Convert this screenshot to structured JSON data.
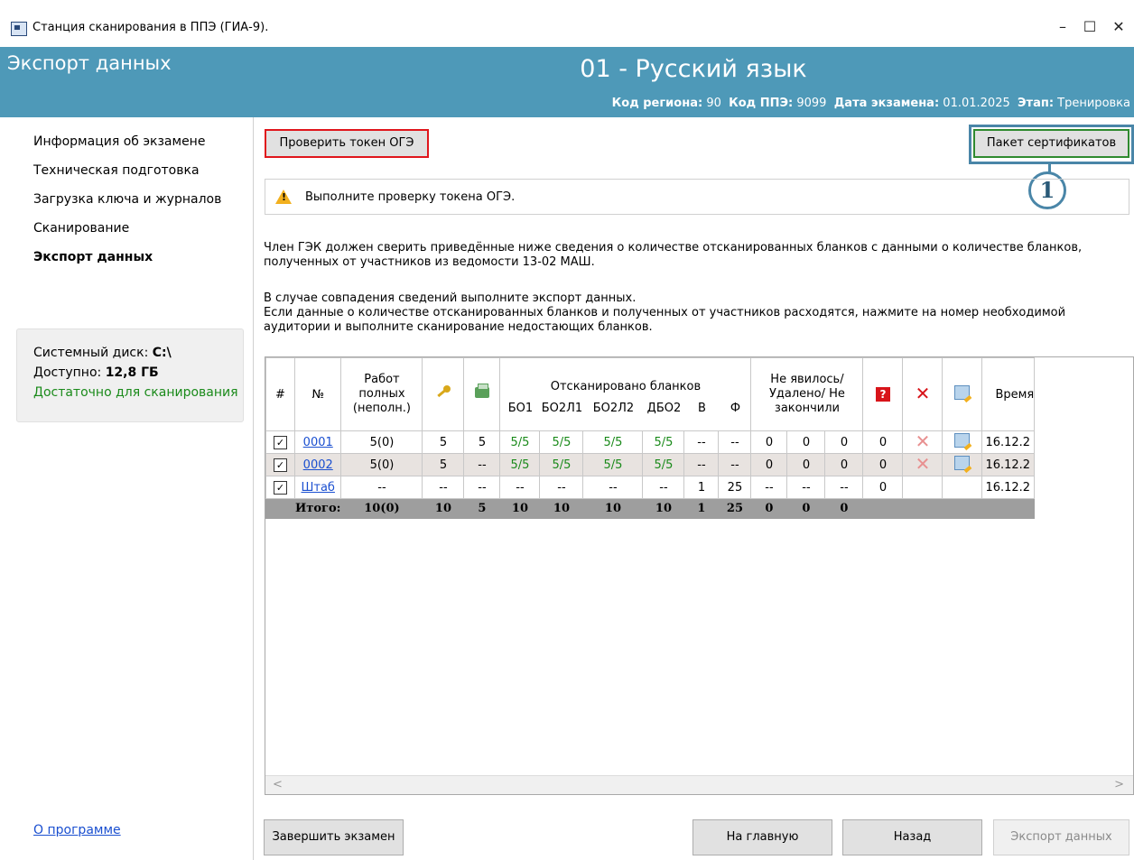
{
  "window": {
    "title": "Станция сканирования в ППЭ (ГИА-9).",
    "minimize": "–",
    "maximize": "☐",
    "close": "✕"
  },
  "header": {
    "section": "Экспорт данных",
    "subject": "01 - Русский язык",
    "region_label": "Код региона:",
    "region_value": "90",
    "ppe_label": "Код ППЭ:",
    "ppe_value": "9099",
    "date_label": "Дата экзамена:",
    "date_value": "01.01.2025",
    "stage_label": "Этап:",
    "stage_value": "Тренировка"
  },
  "sidebar": {
    "items": [
      {
        "label": "Информация об экзамене"
      },
      {
        "label": "Техническая подготовка"
      },
      {
        "label": "Загрузка ключа и журналов"
      },
      {
        "label": "Сканирование"
      },
      {
        "label": "Экспорт данных"
      }
    ],
    "disk": {
      "label": "Системный диск:",
      "value": "C:\\",
      "free_label": "Доступно:",
      "free_value": "12,8 ГБ",
      "status": "Достаточно для сканирования"
    },
    "about": "О программе"
  },
  "toolbar": {
    "check_token": "Проверить токен ОГЭ",
    "cert_package": "Пакет сертификатов",
    "callout": "1"
  },
  "warning": "Выполните проверку токена ОГЭ.",
  "info": {
    "p1": "Член ГЭК должен сверить приведённые ниже сведения о количестве отсканированных бланков с данными о количестве бланков, полученных от участников из ведомости 13-02 МАШ.",
    "p2": "В случае совпадения сведений выполните экспорт данных.",
    "p3": "Если данные о количестве отсканированных бланков и полученных от участников расходятся, нажмите на номер необходимой аудитории и выполните сканирование недостающих бланков."
  },
  "table": {
    "headers": {
      "hash": "#",
      "num": "№",
      "works": "Работ полных (неполн.)",
      "scanned": "Отсканировано бланков",
      "bo1": "БО1",
      "bo2l1": "БО2Л1",
      "bo2l2": "БО2Л2",
      "dbo2": "ДБО2",
      "v": "В",
      "f": "Ф",
      "absent": "Не явилось/ Удалено/ Не закончили",
      "time": "Время"
    },
    "rows": [
      {
        "num": "0001",
        "works": "5(0)",
        "key": "5",
        "scan": "5",
        "bo1": "5/5",
        "bo2l1": "5/5",
        "bo2l2": "5/5",
        "dbo2": "5/5",
        "v": "--",
        "f": "--",
        "a1": "0",
        "a2": "0",
        "a3": "0",
        "q": "0",
        "time": "16.12.2"
      },
      {
        "num": "0002",
        "works": "5(0)",
        "key": "5",
        "scan": "--",
        "bo1": "5/5",
        "bo2l1": "5/5",
        "bo2l2": "5/5",
        "dbo2": "5/5",
        "v": "--",
        "f": "--",
        "a1": "0",
        "a2": "0",
        "a3": "0",
        "q": "0",
        "time": "16.12.2"
      },
      {
        "num": "Штаб",
        "works": "--",
        "key": "--",
        "scan": "--",
        "bo1": "--",
        "bo2l1": "--",
        "bo2l2": "--",
        "dbo2": "--",
        "v": "1",
        "f": "25",
        "a1": "--",
        "a2": "--",
        "a3": "--",
        "q": "0",
        "time": "16.12.2"
      }
    ],
    "total": {
      "label": "Итого:",
      "works": "10(0)",
      "key": "10",
      "scan": "5",
      "bo1": "10",
      "bo2l1": "10",
      "bo2l2": "10",
      "dbo2": "10",
      "v": "1",
      "f": "25",
      "a1": "0",
      "a2": "0",
      "a3": "0"
    }
  },
  "footer": {
    "finish": "Завершить экзамен",
    "home": "На главную",
    "back": "Назад",
    "export": "Экспорт данных"
  },
  "colors": {
    "banner": "#4e99b8",
    "highlight_red": "#e0161c",
    "highlight_green": "#2f8a2f",
    "callout": "#4a86a8"
  }
}
